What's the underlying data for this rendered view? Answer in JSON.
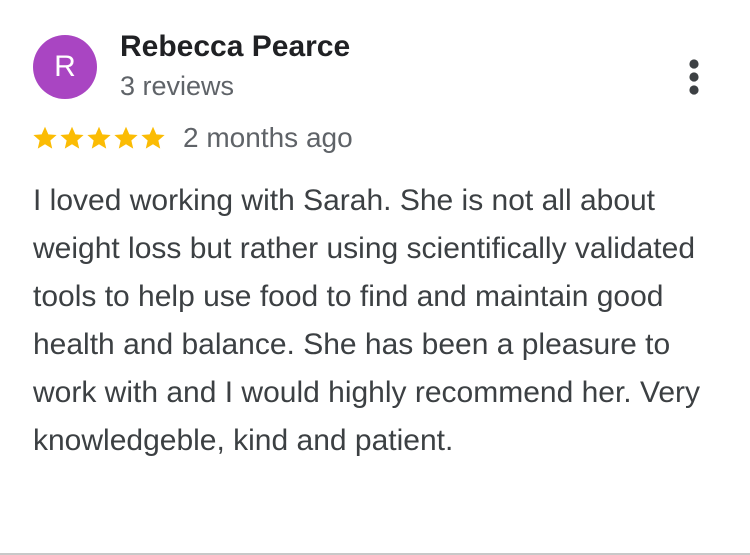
{
  "reviewer": {
    "avatar_initial": "R",
    "avatar_color": "#a945c2",
    "name": "Rebecca Pearce",
    "review_count": "3 reviews"
  },
  "menu": {
    "icon": "more-vert-icon"
  },
  "rating": {
    "stars": 5,
    "max_stars": 5,
    "star_color": "#fbbc04",
    "time_ago": "2 months ago"
  },
  "review": {
    "text": "I loved working with Sarah. She is not all about weight loss but rather using scientifically validated tools to help use food to find and maintain good health and balance. She has been a pleasure to work with and I would highly recommend her. Very knowledgeble, kind and patient."
  }
}
